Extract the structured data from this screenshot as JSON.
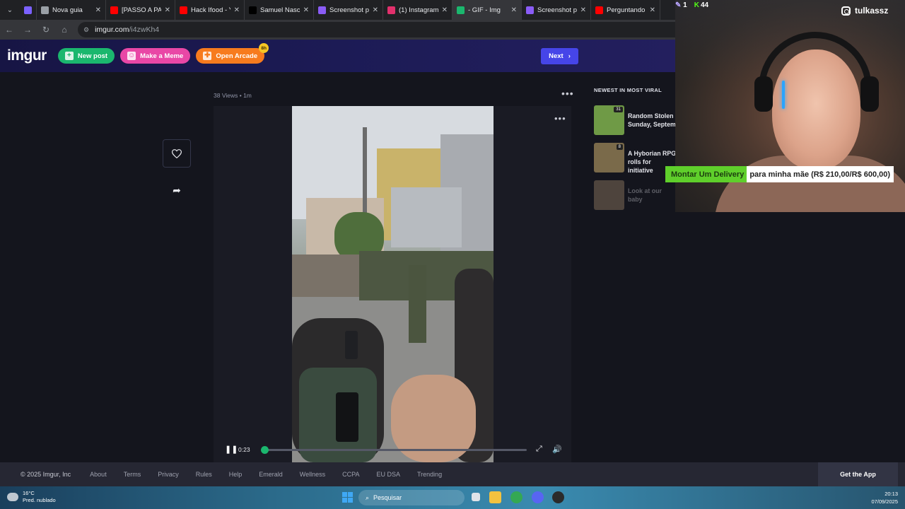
{
  "browser": {
    "tabs": [
      {
        "label": "",
        "color": "#7b61ff",
        "active": false,
        "short": true
      },
      {
        "label": "Nova guia",
        "color": "#9aa0a6",
        "active": false
      },
      {
        "label": "[PASSO A PAS",
        "color": "#ff0000",
        "active": false
      },
      {
        "label": "Hack Ifood - Y",
        "color": "#ff0000",
        "active": false
      },
      {
        "label": "Samuel Nasci",
        "color": "#000000",
        "active": false
      },
      {
        "label": "Screenshot pi",
        "color": "#8a5cf6",
        "active": false
      },
      {
        "label": "(1) Instagram",
        "color": "#e1306c",
        "active": false
      },
      {
        "label": "- GIF - Img",
        "color": "#1bb76e",
        "active": true
      },
      {
        "label": "Screenshot pi",
        "color": "#8a5cf6",
        "active": false
      },
      {
        "label": "Perguntando",
        "color": "#ff0000",
        "active": false
      }
    ],
    "url_host": "imgur.com",
    "url_path": "/i4zwKh4"
  },
  "imgur": {
    "logo": "imgur",
    "new_post": "New post",
    "make_meme": "Make a Meme",
    "open_arcade": "Open Arcade",
    "arcade_badge": "8h",
    "next": "Next",
    "post_views": "38 Views",
    "post_age": "1m",
    "player": {
      "time": "0:23",
      "progress": 0.01
    }
  },
  "sidebar": {
    "title": "NEWEST IN MOST VIRAL",
    "items": [
      {
        "title": "Random Stolen Sunday, Septem",
        "badge": "31",
        "thumb_color": "#6f9a46",
        "dim": false
      },
      {
        "title": "A Hyborian RPG rolls for initiative",
        "badge": "8",
        "thumb_color": "#7a6a4a",
        "dim": false
      },
      {
        "title": "Look at our baby",
        "badge": "",
        "thumb_color": "#b99b7a",
        "dim": true
      }
    ]
  },
  "footer": {
    "copyright": "© 2025 Imgur, Inc",
    "links": [
      "About",
      "Terms",
      "Privacy",
      "Rules",
      "Help",
      "Emerald",
      "Wellness",
      "CCPA",
      "EU DSA",
      "Trending"
    ],
    "get_app": "Get the App"
  },
  "taskbar": {
    "temperature": "16°C",
    "weather": "Pred. nublado",
    "search": "Pesquisar",
    "time": "20:13",
    "date": "07/09/2025"
  },
  "overlay": {
    "instagram": "tulkassz",
    "viewers": "1",
    "kick_label": "K",
    "kick_count": "44",
    "goal_title": "Montar Um Delivery",
    "goal_detail": "para minha mãe (R$ 210,00/R$ 600,00)"
  }
}
